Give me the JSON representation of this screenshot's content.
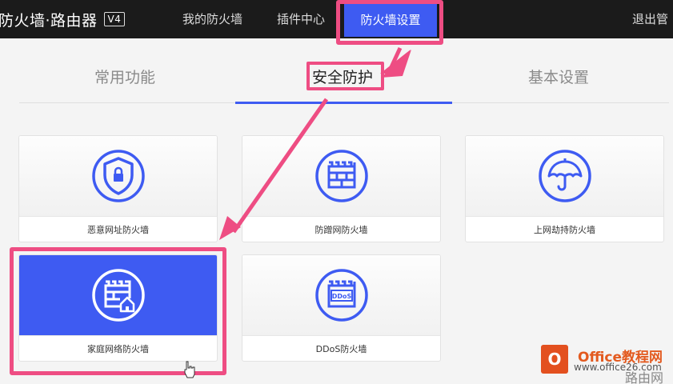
{
  "header": {
    "brand": "防火墙·路由器",
    "version": "V4",
    "nav": [
      {
        "label": "我的防火墙"
      },
      {
        "label": "插件中心"
      },
      {
        "label": "防火墙设置"
      },
      {
        "label": "退出管"
      }
    ]
  },
  "subtabs": [
    {
      "label": "常用功能"
    },
    {
      "label": "安全防护"
    },
    {
      "label": "基本设置"
    }
  ],
  "cards": [
    {
      "label": "恶意网址防火墙",
      "icon": "shield-lock-icon"
    },
    {
      "label": "防蹭网防火墙",
      "icon": "brick-wall-icon"
    },
    {
      "label": "上网劫持防火墙",
      "icon": "umbrella-icon"
    },
    {
      "label": "家庭网络防火墙",
      "icon": "home-wall-icon"
    },
    {
      "label": "DDoS防火墙",
      "icon": "ddos-wall-icon"
    }
  ],
  "ddos_badge": "DDoS",
  "watermark": {
    "title": "Office教程网",
    "url": "www.office26.com",
    "cn": "路由网"
  },
  "colors": {
    "accent": "#3e5bf2",
    "highlight": "#ee4d83",
    "topbar": "#1b1b1b"
  }
}
